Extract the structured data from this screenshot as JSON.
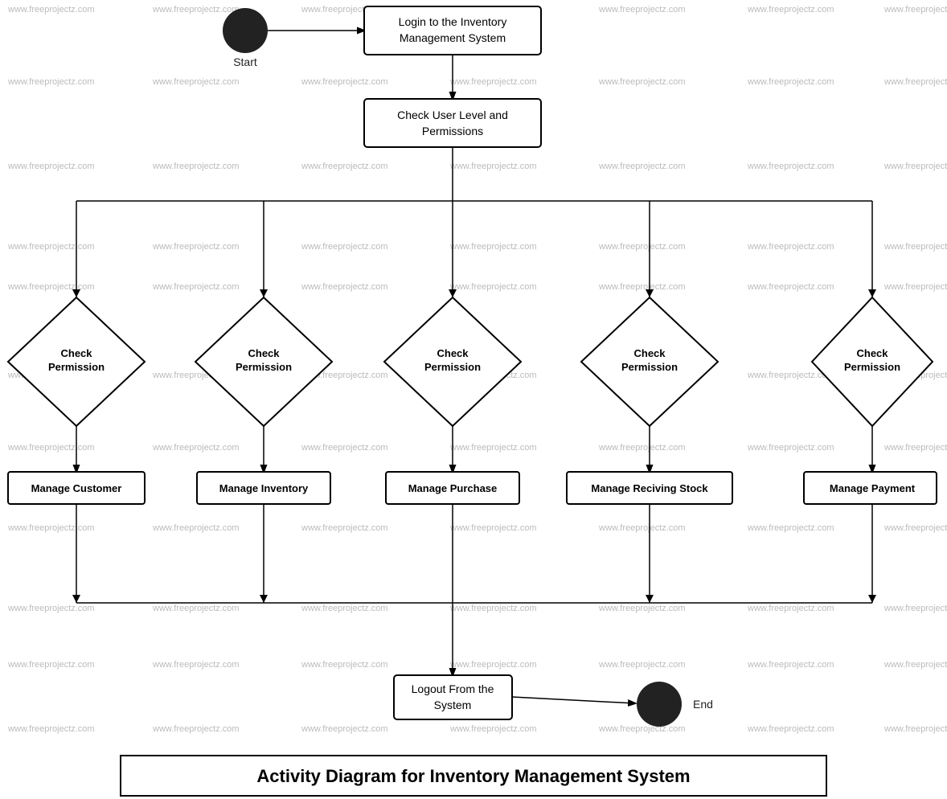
{
  "diagram": {
    "title": "Activity Diagram for Inventory Management System",
    "watermark": "www.freeprojectz.com",
    "nodes": {
      "start_label": "Start",
      "end_label": "End",
      "login": "Login to the Inventory\nManagement System",
      "check_user_level": "Check User Level and\nPermissions",
      "check_permission_1": "Check\nPermission",
      "check_permission_2": "Check\nPermission",
      "check_permission_3": "Check\nPermission",
      "check_permission_4": "Check\nPermission",
      "check_permission_5": "Check\nPermission",
      "manage_customer": "Manage Customer",
      "manage_inventory": "Manage Inventory",
      "manage_purchase": "Manage Purchase",
      "manage_receiving": "Manage Reciving Stock",
      "manage_payment": "Manage Payment",
      "logout": "Logout From the\nSystem"
    }
  }
}
